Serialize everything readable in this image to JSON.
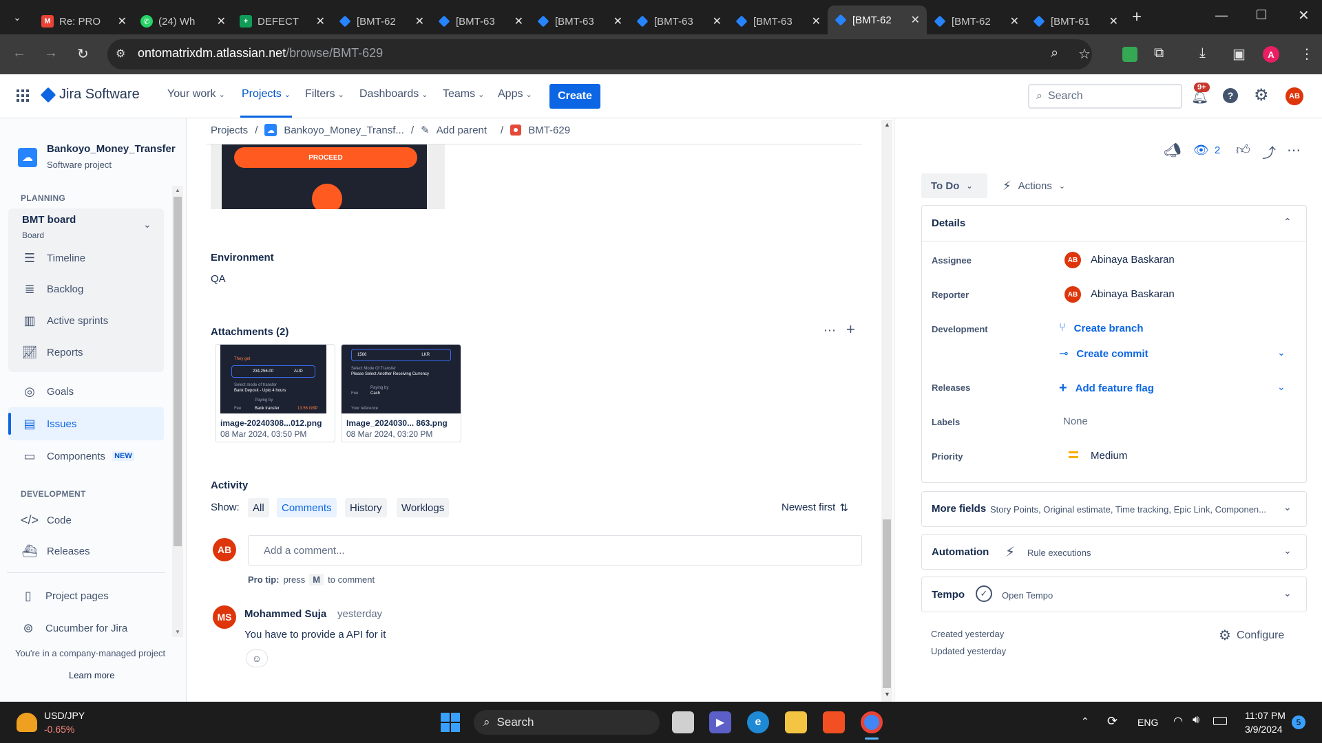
{
  "browser": {
    "tabs": [
      {
        "title": "Re: PRO",
        "icon": "gmail-icon",
        "color": "#ea4335"
      },
      {
        "title": "(24) Wh",
        "icon": "whatsapp-icon",
        "color": "#25d366"
      },
      {
        "title": "DEFECT",
        "icon": "sheets-icon",
        "color": "#0f9d58"
      },
      {
        "title": "[BMT-62",
        "icon": "jira-icon",
        "color": "#2684ff"
      },
      {
        "title": "[BMT-63",
        "icon": "jira-icon",
        "color": "#2684ff"
      },
      {
        "title": "[BMT-63",
        "icon": "jira-icon",
        "color": "#2684ff"
      },
      {
        "title": "[BMT-63",
        "icon": "jira-icon",
        "color": "#2684ff"
      },
      {
        "title": "[BMT-63",
        "icon": "jira-icon",
        "color": "#2684ff"
      },
      {
        "title": "[BMT-62",
        "icon": "jira-icon",
        "color": "#2684ff"
      },
      {
        "title": "[BMT-62",
        "icon": "jira-icon",
        "color": "#2684ff"
      },
      {
        "title": "[BMT-61",
        "icon": "jira-icon",
        "color": "#2684ff"
      }
    ],
    "url_host": "ontomatrixdm.atlassian.net",
    "url_path": "/browse/BMT-629",
    "profile_initial": "A"
  },
  "header": {
    "product": "Jira Software",
    "nav": [
      "Your work",
      "Projects",
      "Filters",
      "Dashboards",
      "Teams",
      "Apps"
    ],
    "create": "Create",
    "search_placeholder": "Search",
    "notifications": "9+",
    "user_initials": "AB"
  },
  "sidebar": {
    "project_name": "Bankoyo_Money_Transfer",
    "project_type": "Software project",
    "planning": "PLANNING",
    "board_name": "BMT board",
    "board_sub": "Board",
    "planning_items": [
      "Timeline",
      "Backlog",
      "Active sprints",
      "Reports"
    ],
    "goals": "Goals",
    "issues": "Issues",
    "components": "Components",
    "new_badge": "NEW",
    "development": "DEVELOPMENT",
    "dev_items": [
      "Code",
      "Releases"
    ],
    "project_pages": "Project pages",
    "cucumber": "Cucumber for Jira",
    "footer": "You're in a company-managed project",
    "learn_more": "Learn more"
  },
  "breadcrumb": {
    "projects": "Projects",
    "project": "Bankoyo_Money_Transf...",
    "add_parent": "Add parent",
    "issue_key": "BMT-629"
  },
  "main": {
    "proceed_label": "PROCEED",
    "environment_label": "Environment",
    "environment_value": "QA",
    "attachments_label": "Attachments (2)",
    "attachments": [
      {
        "name": "image-20240308...012.png",
        "date": "08 Mar 2024, 03:50 PM",
        "preview_text": "They get",
        "amount": "234,256.00",
        "currency": "AUD",
        "row1": "Select mode of transfer",
        "row2": "Bank Deposit - Upto 4 hours",
        "row3": "Paying by",
        "row4": "Fee",
        "row5": "Bank transfer",
        "row6": "13.56 GBP"
      },
      {
        "name": "Image_2024030... 863.png",
        "date": "08 Mar 2024, 03:20 PM",
        "preview_text": "1566",
        "currency": "LKR",
        "row1": "Select Mode Of Transfer",
        "row2": "Please Select Another Receiving Currency",
        "row3": "Paying by",
        "row4": "Fee",
        "row5": "Cash",
        "row6": "Your reference"
      }
    ],
    "activity_label": "Activity",
    "show_label": "Show:",
    "filters": [
      "All",
      "Comments",
      "History",
      "Worklogs"
    ],
    "sort": "Newest first",
    "comment_placeholder": "Add a comment...",
    "protip_prefix": "Pro tip:",
    "protip_press": "press",
    "protip_key": "M",
    "protip_suffix": "to comment",
    "comment": {
      "initials": "MS",
      "author": "Mohammed Suja",
      "time": "yesterday",
      "text": "You have to provide a API for it"
    }
  },
  "panel": {
    "watchers": "2",
    "status": "To Do",
    "actions": "Actions",
    "details": "Details",
    "assignee_label": "Assignee",
    "assignee": "Abinaya Baskaran",
    "reporter_label": "Reporter",
    "reporter": "Abinaya Baskaran",
    "avatar_initials": "AB",
    "development_label": "Development",
    "create_branch": "Create branch",
    "create_commit": "Create commit",
    "releases_label": "Releases",
    "add_feature_flag": "Add feature flag",
    "labels_label": "Labels",
    "labels_value": "None",
    "priority_label": "Priority",
    "priority_value": "Medium",
    "more_fields": "More fields",
    "more_fields_sub": "Story Points, Original estimate, Time tracking, Epic Link, Componen...",
    "automation": "Automation",
    "rule_executions": "Rule executions",
    "tempo": "Tempo",
    "open_tempo": "Open Tempo",
    "created": "Created yesterday",
    "updated": "Updated yesterday",
    "configure": "Configure"
  },
  "taskbar": {
    "ticker": "USD/JPY",
    "change": "-0.65%",
    "search": "Search",
    "lang": "ENG",
    "time": "11:07 PM",
    "date": "3/9/2024",
    "notif_count": "5"
  }
}
